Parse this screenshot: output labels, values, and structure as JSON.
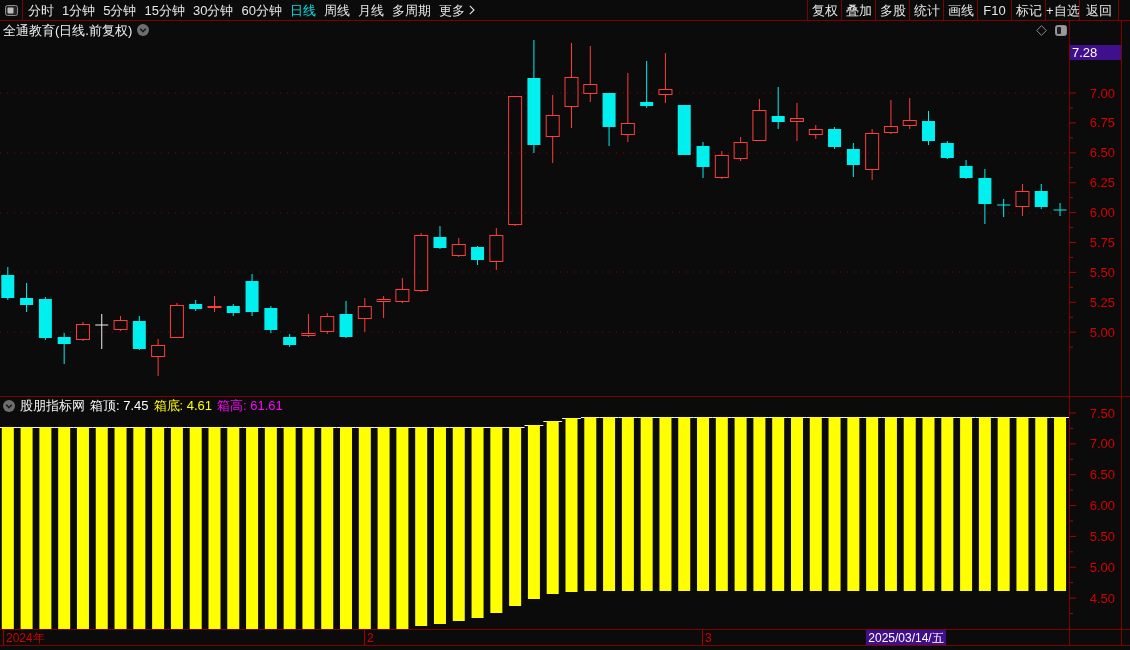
{
  "toolbar": {
    "periods": [
      {
        "label": "分时",
        "selected": false
      },
      {
        "label": "1分钟",
        "selected": false
      },
      {
        "label": "5分钟",
        "selected": false
      },
      {
        "label": "15分钟",
        "selected": false
      },
      {
        "label": "30分钟",
        "selected": false
      },
      {
        "label": "60分钟",
        "selected": false
      },
      {
        "label": "日线",
        "selected": true
      },
      {
        "label": "周线",
        "selected": false
      },
      {
        "label": "月线",
        "selected": false
      },
      {
        "label": "多周期",
        "selected": false
      }
    ],
    "more": "更多",
    "actions": [
      "复权",
      "叠加",
      "多股",
      "统计",
      "画线",
      "F10",
      "标记",
      "+自选",
      "返回"
    ]
  },
  "price_chart": {
    "title": "全通教育(日线.前复权)",
    "current_price": "7.28",
    "axis_labels": [
      "7.00",
      "6.75",
      "6.50",
      "6.25",
      "6.00",
      "5.75",
      "5.50",
      "5.25",
      "5.00"
    ]
  },
  "indicator": {
    "name": "股朋指标网",
    "readings": [
      {
        "text": "箱顶: 7.45",
        "color": "#ffffff"
      },
      {
        "text": "箱底: 4.61",
        "color": "#ffff00"
      },
      {
        "text": "箱高: 61.61",
        "color": "#ff00ff"
      }
    ],
    "axis_labels": [
      "7.50",
      "7.00",
      "6.50",
      "6.00",
      "5.50",
      "5.00",
      "4.50"
    ]
  },
  "date_axis": {
    "labels": [
      "2024年",
      "2",
      "3"
    ],
    "cursor_date": "2025/03/14/五"
  }
}
